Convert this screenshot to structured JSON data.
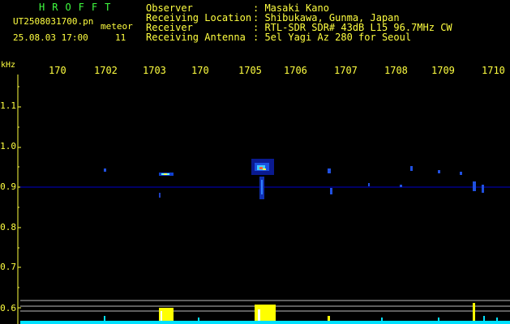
{
  "header": {
    "logo": "HROFFT",
    "filename": "UT2508031700.pn",
    "mode": "meteor",
    "datetime": "25.08.03 17:00",
    "count": "11",
    "fields": [
      {
        "label": "Observer",
        "value": ": Masaki Kano"
      },
      {
        "label": "Receiving Location",
        "value": ": Shibukawa, Gunma, Japan"
      },
      {
        "label": "Receiver",
        "value": ": RTL-SDR SDR# 43dB L15 96.7MHz CW"
      },
      {
        "label": "Receiving Antenna",
        "value": ": 5el Yagi Az 280 for Seoul"
      }
    ]
  },
  "y_axis": {
    "unit": "kHz",
    "ticks": [
      "1.1",
      "1.0",
      "0.9",
      "0.8",
      "0.7",
      "0.6"
    ]
  },
  "x_axis": {
    "ticks": [
      "170",
      "1702",
      "1703",
      "170",
      "1705",
      "1706",
      "1707",
      "1708",
      "1709",
      "1710"
    ]
  },
  "colors": {
    "header_text": "#ffffff",
    "logo": "#40ff40",
    "filename": "#ffff40",
    "axis_text": "#ffff40",
    "field_labels": "#ffff40",
    "field_values": "#ffff40",
    "background": "#000000",
    "noise_floor": "#00e0ff",
    "burst": "#ffff00"
  }
}
